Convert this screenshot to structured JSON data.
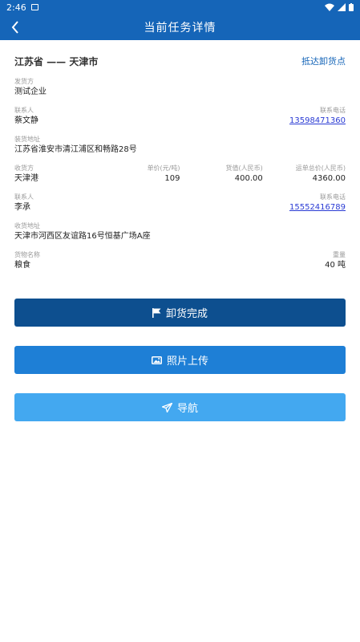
{
  "status_bar": {
    "time": "2:46"
  },
  "header": {
    "title": "当前任务详情"
  },
  "route": {
    "text": "江苏省 —— 天津市",
    "action": "抵达卸货点"
  },
  "shipper": {
    "label": "发货方",
    "value": "测试企业",
    "contact_label": "联系人",
    "contact": "蔡文静",
    "phone_label": "联系电话",
    "phone": "13598471360",
    "address_label": "装货地址",
    "address": "江苏省淮安市清江浦区和畅路28号"
  },
  "receiver": {
    "label": "收货方",
    "value": "天津港",
    "unit_price_label": "单价(元/吨)",
    "unit_price": "109",
    "goods_value_label": "货值(人民币)",
    "goods_value": "400.00",
    "total_label": "运单总价(人民币)",
    "total": "4360.00",
    "contact_label": "联系人",
    "contact": "李承",
    "phone_label": "联系电话",
    "phone": "15552416789",
    "address_label": "收货地址",
    "address": "天津市河西区友谊路16号恒基广场A座"
  },
  "cargo": {
    "name_label": "货物名称",
    "name": "粮食",
    "weight_label": "重量",
    "weight": "40 吨"
  },
  "buttons": {
    "done": "卸货完成",
    "photo": "照片上传",
    "navigate": "导航"
  },
  "colors": {
    "primary": "#1565b8",
    "done_button": "#0d4f8f",
    "photo_button": "#1e7fd6",
    "nav_button": "#43a8f0",
    "phone_link": "#2a3bd4"
  }
}
